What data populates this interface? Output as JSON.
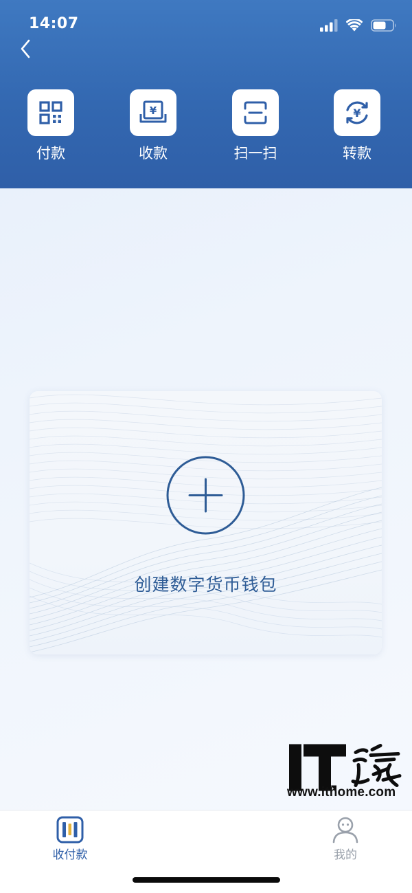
{
  "status_bar": {
    "time": "14:07",
    "icons": [
      "cellular-signal-icon",
      "wifi-icon",
      "battery-icon"
    ]
  },
  "header": {
    "back_icon": "chevron-left-icon",
    "actions": [
      {
        "label": "付款",
        "icon": "qr-code-icon"
      },
      {
        "label": "收款",
        "icon": "receive-money-icon"
      },
      {
        "label": "扫一扫",
        "icon": "scan-icon"
      },
      {
        "label": "转款",
        "icon": "transfer-icon"
      }
    ]
  },
  "wallet_card": {
    "label": "创建数字货币钱包",
    "icon": "plus-circle-icon"
  },
  "watermark": {
    "logo": "IT之家",
    "url": "www.ithome.com"
  },
  "tab_bar": {
    "tabs": [
      {
        "label": "收付款",
        "icon": "wallet-icon",
        "active": true
      },
      {
        "label": "我的",
        "icon": "user-profile-icon",
        "active": false
      }
    ]
  },
  "colors": {
    "header": "#3368b1",
    "accent": "#2f5fa8",
    "card_text": "#2e5c96",
    "inactive_tab": "#9aa1ab",
    "wallet_icon_accent": "#e3b23c"
  }
}
